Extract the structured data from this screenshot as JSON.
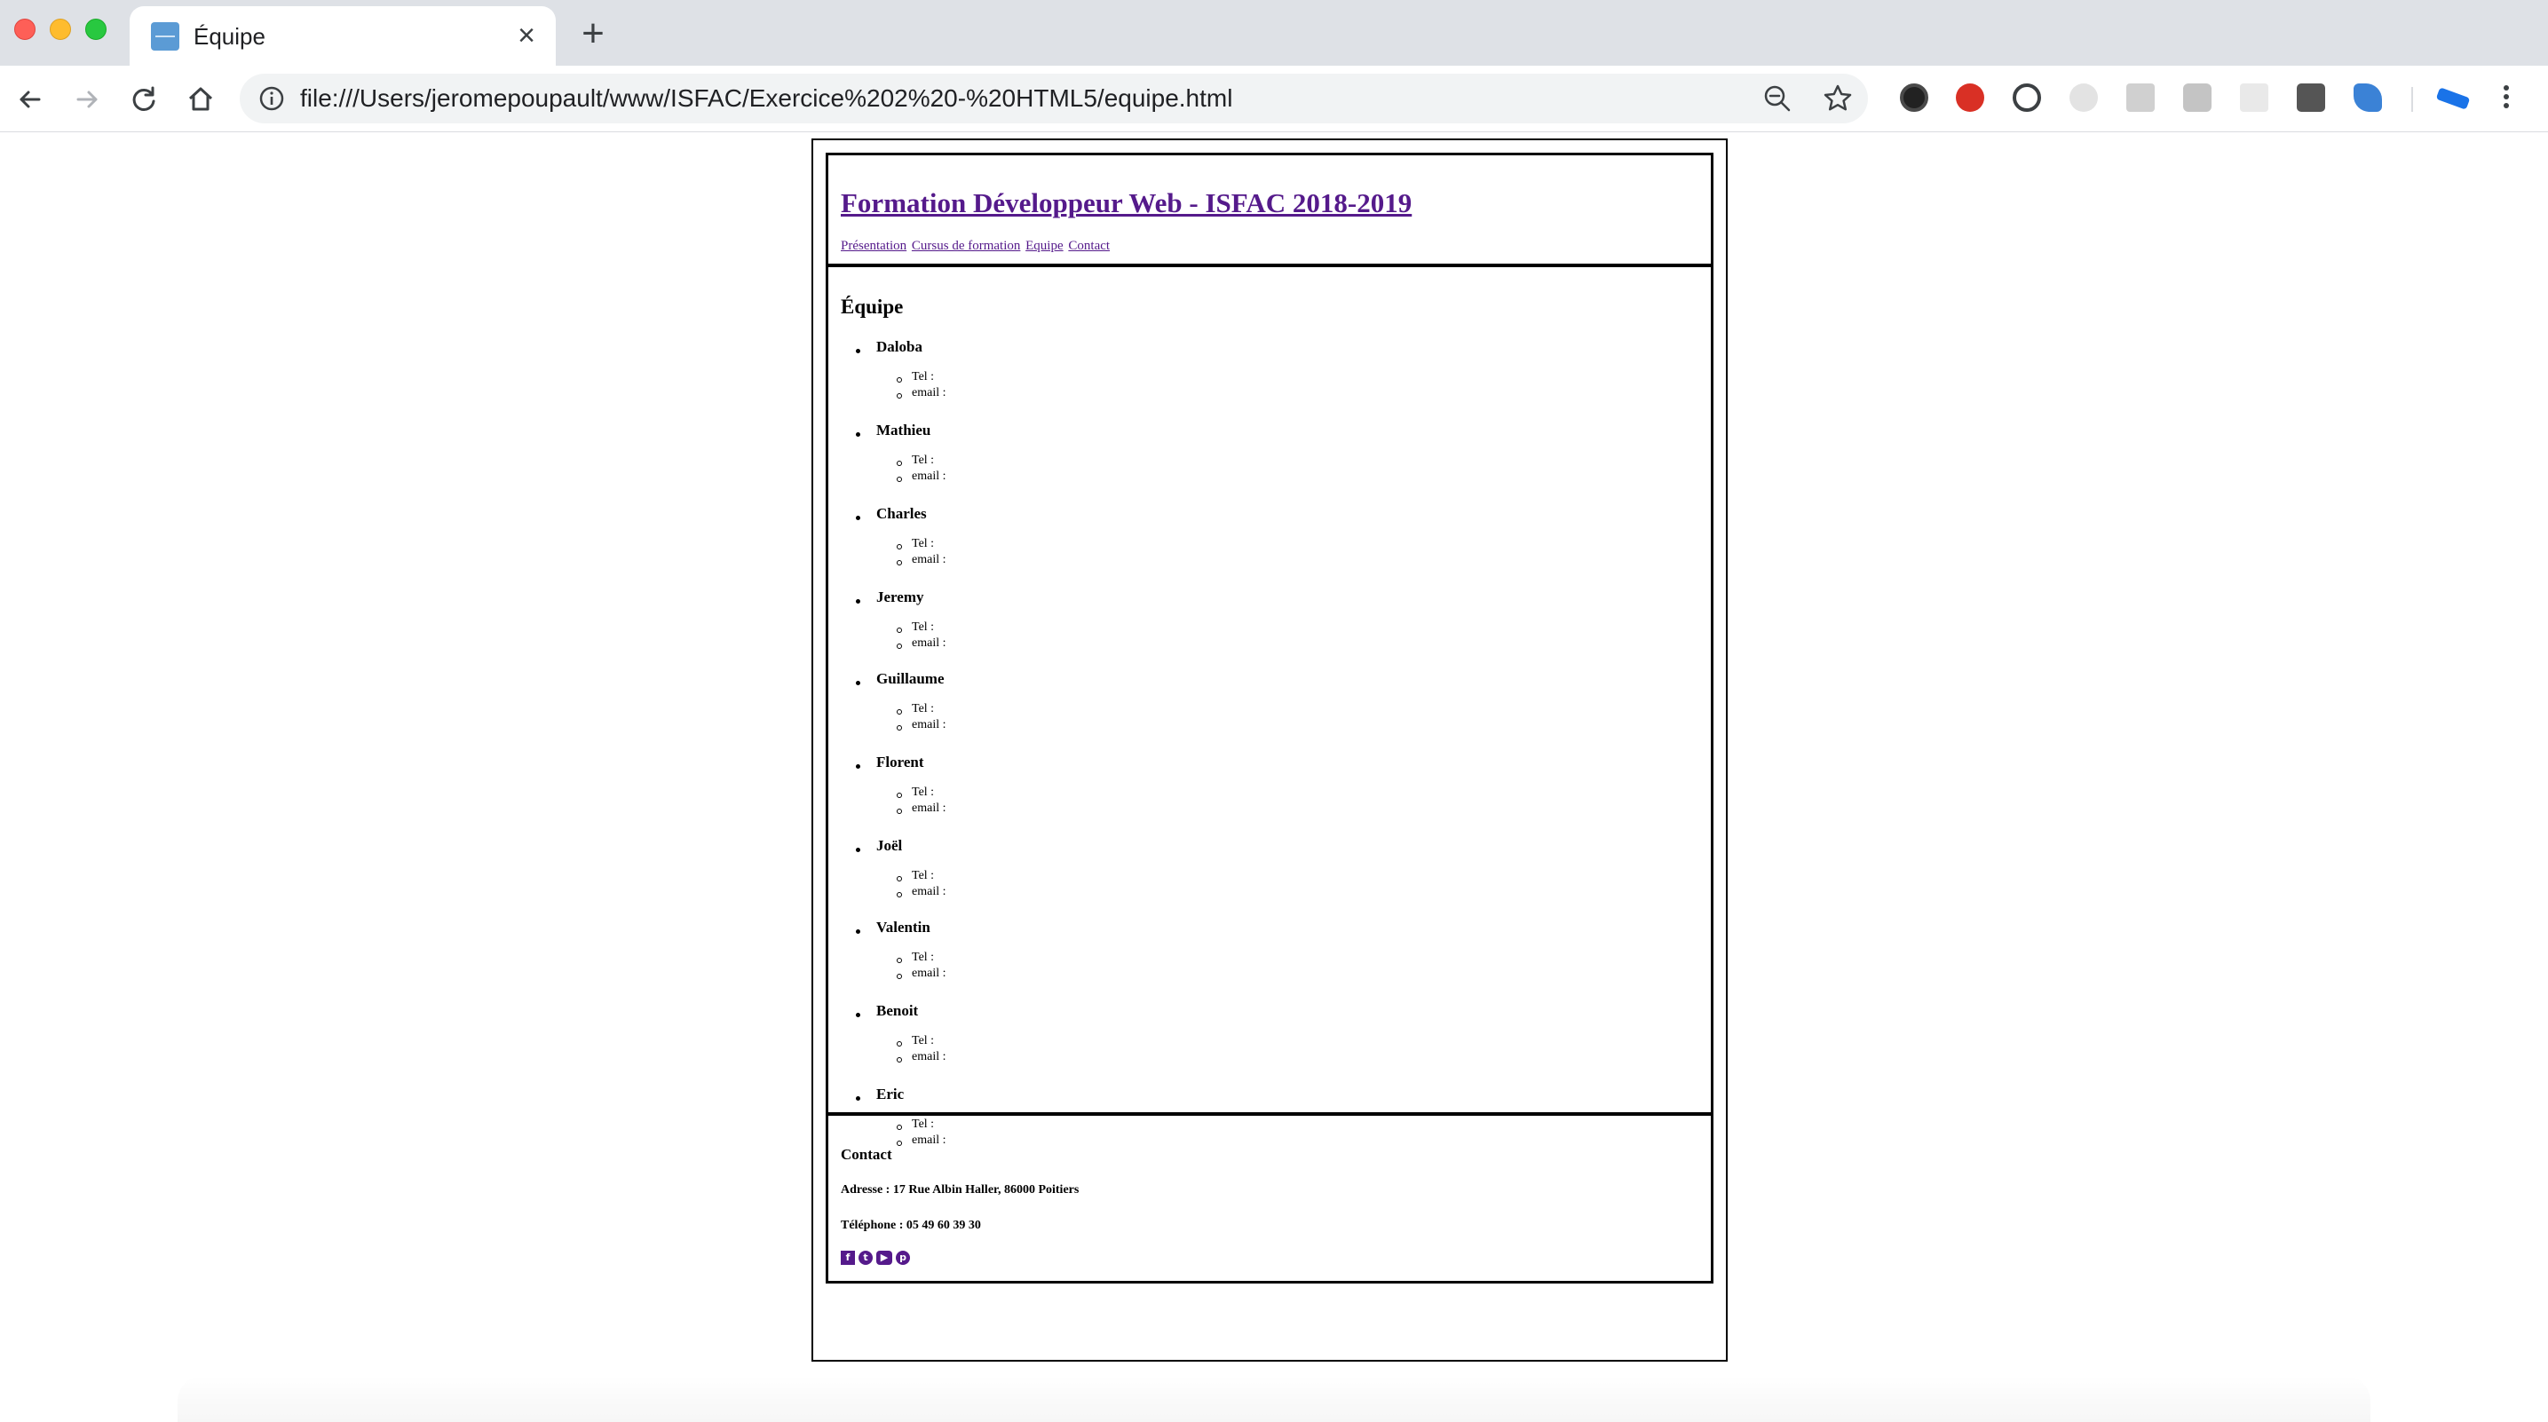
{
  "browser": {
    "tab_title": "Équipe",
    "url": "file:///Users/jeromepoupault/www/ISFAC/Exercice%202%20-%20HTML5/equipe.html"
  },
  "page": {
    "site_title": "Formation Développeur Web - ISFAC 2018-2019",
    "nav": [
      "Présentation",
      "Cursus de formation",
      "Equipe",
      "Contact"
    ],
    "main_title": "Équipe",
    "tel_label": "Tel :",
    "email_label": "email :",
    "members": [
      "Daloba",
      "Mathieu",
      "Charles",
      "Jeremy",
      "Guillaume",
      "Florent",
      "Joël",
      "Valentin",
      "Benoit",
      "Eric"
    ],
    "footer": {
      "title": "Contact",
      "address": "Adresse : 17 Rue Albin Haller, 86000 Poitiers",
      "phone": "Téléphone : 05 49 60 39 30",
      "social_icons": [
        "facebook-icon",
        "twitter-icon",
        "youtube-icon",
        "pinterest-icon"
      ]
    }
  }
}
